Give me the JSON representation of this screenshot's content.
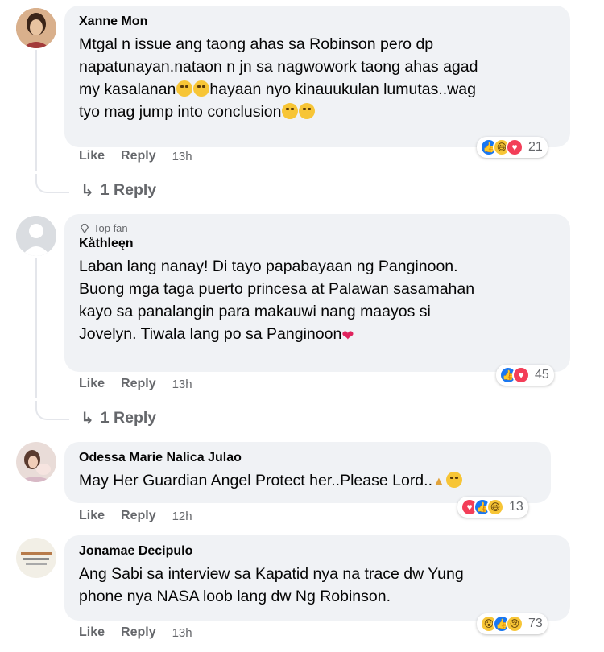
{
  "comments": [
    {
      "author": "Xanne Mon",
      "top_fan": "",
      "text": "Mtgal n issue ang taong ahas sa Robinson pero dp napatunayan.nataon n jn sa nagwowork taong ahas agad my kasalanan😩😩hayaan nyo kinauukulan lumutas..wag tyo mag jump into conclusion😩😩",
      "text_lines": [
        "Mtgal n issue ang taong ahas sa Robinson pero dp",
        "napatunayan.nataon n jn sa nagwowork taong ahas agad",
        "my kasalanan",
        "hayaan nyo kinauukulan lumutas..wag",
        "tyo mag jump into conclusion"
      ],
      "like": "Like",
      "reply": "Reply",
      "time": "13h",
      "reaction_count": "21",
      "reactions": [
        "like",
        "haha",
        "love"
      ],
      "replies_label": "1 Reply"
    },
    {
      "author": "Kåthleęn",
      "top_fan": "Top fan",
      "text_lines": [
        "Laban lang nanay! Di tayo papabayaan ng Panginoon.",
        "Buong mga taga puerto princesa at Palawan sasamahan",
        "kayo sa panalangin para makauwi nang maayos si",
        "Jovelyn. Tiwala lang po sa Panginoon"
      ],
      "like": "Like",
      "reply": "Reply",
      "time": "13h",
      "reaction_count": "45",
      "reactions": [
        "like",
        "love"
      ],
      "replies_label": "1 Reply"
    },
    {
      "author": "Odessa Marie Nalica Julao",
      "top_fan": "",
      "text_lines": [
        "May Her Guardian Angel Protect her..Please Lord.."
      ],
      "like": "Like",
      "reply": "Reply",
      "time": "12h",
      "reaction_count": "13",
      "reactions": [
        "love",
        "like",
        "haha"
      ]
    },
    {
      "author": "Jonamae Decipulo",
      "top_fan": "",
      "text_lines": [
        "Ang Sabi sa interview sa Kapatid nya na trace dw Yung",
        "phone nya NASA loob lang dw Ng Robinson."
      ],
      "like": "Like",
      "reply": "Reply",
      "time": "13h",
      "reaction_count": "73",
      "reactions": [
        "wow",
        "like",
        "sad"
      ]
    }
  ],
  "colors": {
    "bubble": "#f0f2f5",
    "meta": "#65676b",
    "like_blue": "#1877f2",
    "love_red": "#f33e58",
    "haha_yellow": "#f7c536"
  }
}
